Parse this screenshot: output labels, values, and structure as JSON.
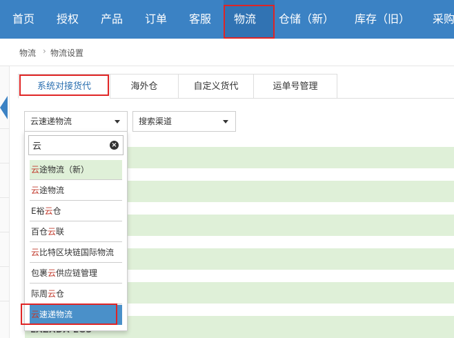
{
  "nav": {
    "items": [
      "首页",
      "授权",
      "产品",
      "订单",
      "客服",
      "物流",
      "仓储（新）",
      "库存（旧）",
      "采购"
    ],
    "active_index": 5
  },
  "breadcrumb": [
    "物流",
    "物流设置"
  ],
  "tabs": {
    "items": [
      "系统对接货代",
      "海外仓",
      "自定义货代",
      "运单号管理"
    ],
    "active_index": 0
  },
  "filters": {
    "logistics_select": "云速递物流",
    "channel_select": "搜索渠道"
  },
  "dropdown": {
    "search_value": "云",
    "items": [
      {
        "pre": "",
        "hl": "云",
        "post": "途物流（新）",
        "state": "hover"
      },
      {
        "pre": "",
        "hl": "云",
        "post": "途物流",
        "state": ""
      },
      {
        "pre": "E裕",
        "hl": "云",
        "post": "仓",
        "state": ""
      },
      {
        "pre": "百仓",
        "hl": "云",
        "post": "联",
        "state": ""
      },
      {
        "pre": "",
        "hl": "云",
        "post": "比特区块链国际物流",
        "state": ""
      },
      {
        "pre": "包裹",
        "hl": "云",
        "post": "供应链管理",
        "state": ""
      },
      {
        "pre": "际周",
        "hl": "云",
        "post": "仓",
        "state": ""
      },
      {
        "pre": "",
        "hl": "云",
        "post": "速递物流",
        "state": "selected"
      }
    ]
  },
  "list": {
    "last_row_label": "LAZADA LGS"
  },
  "colors": {
    "nav_bg": "#3b82c4",
    "nav_active": "#3173b3",
    "highlight_red": "#e02424",
    "row_green": "#dff0d8",
    "selected_blue": "#4a90c9"
  }
}
